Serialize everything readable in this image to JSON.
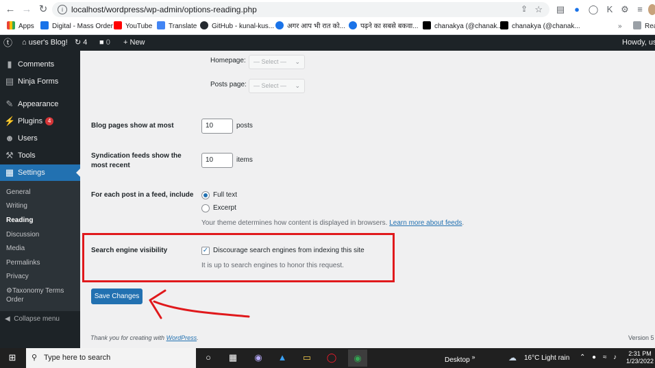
{
  "browser": {
    "url": "localhost/wordpress/wp-admin/options-reading.php",
    "bookmarks": [
      {
        "label": "Apps",
        "color": "#5f6368",
        "icon": "apps-grid-icon"
      },
      {
        "label": "Digital - Mass Order",
        "color": "#1a73e8",
        "icon": "csc-icon"
      },
      {
        "label": "YouTube",
        "color": "#ff0000",
        "icon": "youtube-icon"
      },
      {
        "label": "Translate",
        "color": "#4285f4",
        "icon": "translate-icon"
      },
      {
        "label": "GitHub - kunal-kus...",
        "color": "#24292f",
        "icon": "github-icon"
      },
      {
        "label": "अगर आप भी रात को...",
        "color": "#1a73e8",
        "icon": "site-icon"
      },
      {
        "label": "पढ़ने का सबसे बकवा...",
        "color": "#1a73e8",
        "icon": "site-icon"
      },
      {
        "label": "chanakya (@chanak...",
        "color": "#000000",
        "icon": "tiktok-icon"
      },
      {
        "label": "chanakya (@chanak...",
        "color": "#000000",
        "icon": "tiktok-icon"
      },
      {
        "label": "Rea",
        "color": "#5f6368",
        "icon": "reading-list-icon"
      }
    ]
  },
  "adminbar": {
    "site_name": "user's Blog!",
    "updates_count": "4",
    "comments_count": "0",
    "new_label": "New",
    "howdy": "Howdy, use"
  },
  "sidebar": {
    "items": [
      {
        "label": "Comments",
        "icon": "comments-icon"
      },
      {
        "label": "Ninja Forms",
        "icon": "ninja-forms-icon"
      },
      {
        "label": "Appearance",
        "icon": "appearance-icon"
      },
      {
        "label": "Plugins",
        "icon": "plugins-icon",
        "badge": "4"
      },
      {
        "label": "Users",
        "icon": "users-icon"
      },
      {
        "label": "Tools",
        "icon": "tools-icon"
      },
      {
        "label": "Settings",
        "icon": "settings-icon"
      }
    ],
    "submenu": [
      "General",
      "Writing",
      "Reading",
      "Discussion",
      "Media",
      "Permalinks",
      "Privacy",
      "Taxonomy Terms Order"
    ],
    "current_submenu": "Reading",
    "collapse_label": "Collapse menu"
  },
  "main": {
    "homepage_label": "Homepage:",
    "posts_page_label": "Posts page:",
    "select_placeholder": "— Select —",
    "blog_pages_label": "Blog pages show at most",
    "blog_pages_value": "10",
    "blog_pages_unit": "posts",
    "syndication_label_1": "Syndication feeds show the",
    "syndication_label_2": "most recent",
    "syndication_value": "10",
    "syndication_unit": "items",
    "feed_include_label": "For each post in a feed, include",
    "feed_full_text": "Full text",
    "feed_excerpt": "Excerpt",
    "feed_full_text_selected": true,
    "feed_desc": "Your theme determines how content is displayed in browsers.",
    "feed_desc_link": "Learn more about feeds",
    "feed_desc_end": ".",
    "sev_label": "Search engine visibility",
    "sev_checkbox_label": "Discourage search engines from indexing this site",
    "sev_checked": true,
    "sev_desc": "It is up to search engines to honor this request.",
    "save_button": "Save Changes",
    "footer_thanks": "Thank you for creating with",
    "footer_link": "WordPress",
    "footer_period": ".",
    "footer_version": "Version 5",
    "highlight_color": "#e0191c"
  },
  "taskbar": {
    "search_placeholder": "Type here to search",
    "desktop_label": "Desktop",
    "weather": "16°C  Light rain",
    "time": "2:31 PM",
    "date": "1/23/2022"
  }
}
